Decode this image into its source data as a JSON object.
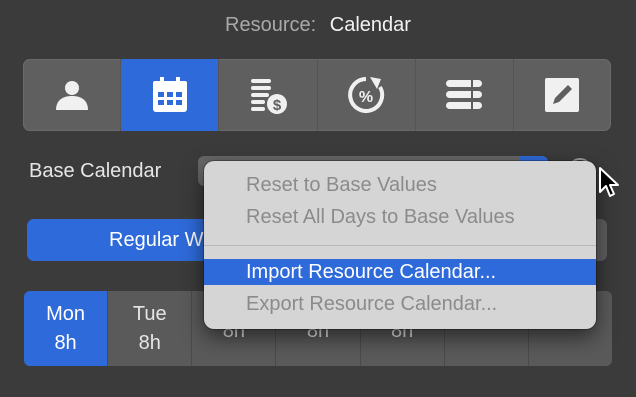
{
  "header": {
    "label": "Resource:",
    "value": "Calendar"
  },
  "tabs": [
    {
      "name": "person-icon",
      "active": false
    },
    {
      "name": "calendar-icon",
      "active": true
    },
    {
      "name": "cost-icon",
      "active": false
    },
    {
      "name": "percent-cycle-icon",
      "active": false
    },
    {
      "name": "list-icon",
      "active": false
    },
    {
      "name": "edit-icon",
      "active": false
    }
  ],
  "base_calendar": {
    "label": "Base Calendar"
  },
  "regular_button": {
    "label": "Regular W"
  },
  "days": [
    {
      "name": "Mon",
      "hours": "8h",
      "active": true
    },
    {
      "name": "Tue",
      "hours": "8h",
      "active": false
    },
    {
      "name": "",
      "hours": "8h",
      "active": false
    },
    {
      "name": "",
      "hours": "8h",
      "active": false
    },
    {
      "name": "",
      "hours": "8h",
      "active": false
    },
    {
      "name": "",
      "hours": "",
      "active": false
    },
    {
      "name": "",
      "hours": "",
      "active": false
    }
  ],
  "menu": {
    "items": [
      {
        "label": "Reset to Base Values",
        "enabled": false
      },
      {
        "label": "Reset All Days to Base Values",
        "enabled": false
      },
      {
        "label": "Import Resource Calendar...",
        "enabled": true,
        "highlighted": true
      },
      {
        "label": "Export Resource Calendar...",
        "enabled": false
      }
    ]
  },
  "colors": {
    "accent": "#2e6ad9",
    "background": "#3b3b3b",
    "menu": "#d5d5d5"
  }
}
